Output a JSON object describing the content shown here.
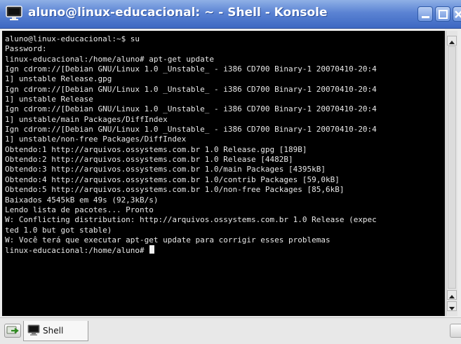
{
  "window": {
    "title": "aluno@linux-educacional: ~ - Shell - Konsole"
  },
  "terminal": {
    "lines": [
      "aluno@linux-educacional:~$ su",
      "Password:",
      "linux-educacional:/home/aluno# apt-get update",
      "Ign cdrom://[Debian GNU/Linux 1.0 _Unstable_ - i386 CD700 Binary-1 20070410-20:4",
      "1] unstable Release.gpg",
      "Ign cdrom://[Debian GNU/Linux 1.0 _Unstable_ - i386 CD700 Binary-1 20070410-20:4",
      "1] unstable Release",
      "Ign cdrom://[Debian GNU/Linux 1.0 _Unstable_ - i386 CD700 Binary-1 20070410-20:4",
      "1] unstable/main Packages/DiffIndex",
      "Ign cdrom://[Debian GNU/Linux 1.0 _Unstable_ - i386 CD700 Binary-1 20070410-20:4",
      "1] unstable/non-free Packages/DiffIndex",
      "Obtendo:1 http://arquivos.ossystems.com.br 1.0 Release.gpg [189B]",
      "Obtendo:2 http://arquivos.ossystems.com.br 1.0 Release [4482B]",
      "Obtendo:3 http://arquivos.ossystems.com.br 1.0/main Packages [4395kB]",
      "Obtendo:4 http://arquivos.ossystems.com.br 1.0/contrib Packages [59,0kB]",
      "Obtendo:5 http://arquivos.ossystems.com.br 1.0/non-free Packages [85,6kB]",
      "Baixados 4545kB em 49s (92,3kB/s)",
      "Lendo lista de pacotes... Pronto",
      "W: Conflicting distribution: http://arquivos.ossystems.com.br 1.0 Release (expec",
      "ted 1.0 but got stable)",
      "W: Você terá que executar apt-get update para corrigir esses problemas"
    ],
    "prompt": "linux-educacional:/home/aluno# "
  },
  "tabs": [
    {
      "label": "Shell"
    }
  ],
  "colors": {
    "titlebar": "#4f78cc",
    "terminal_bg": "#000000",
    "terminal_fg": "#e8e8e8"
  }
}
